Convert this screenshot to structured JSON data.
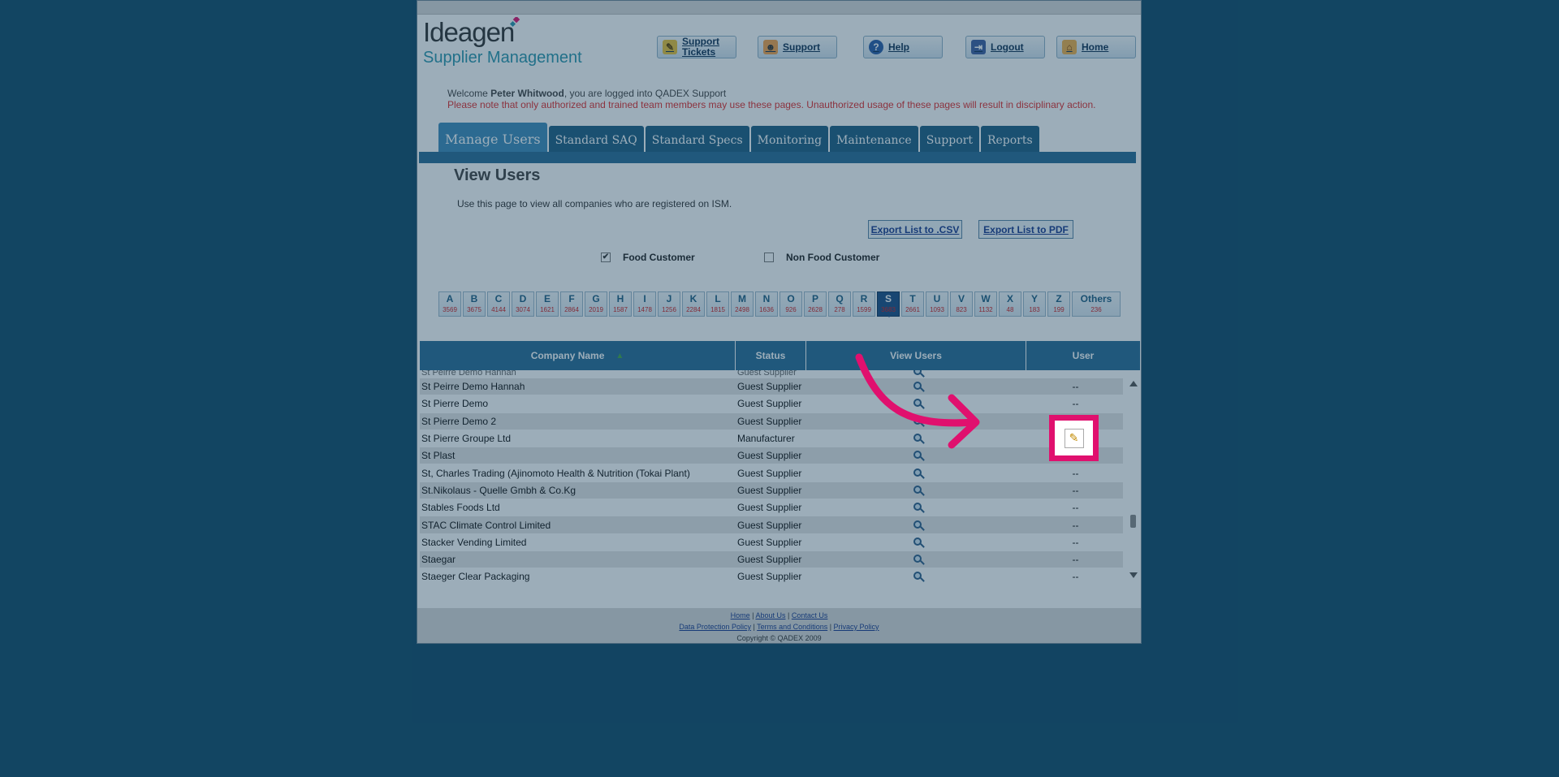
{
  "header": {
    "logo_main": "Ideagen",
    "logo_sub": "Supplier Management",
    "buttons": [
      {
        "label": "Support Tickets",
        "icon": "ticket-icon"
      },
      {
        "label": "Support",
        "icon": "user-icon"
      },
      {
        "label": "Help",
        "icon": "help-icon"
      },
      {
        "label": "Logout",
        "icon": "logout-icon"
      },
      {
        "label": "Home",
        "icon": "home-icon"
      }
    ],
    "welcome_prefix": "Welcome ",
    "welcome_user": "Peter Whitwood",
    "welcome_suffix": ", you are logged into QADEX Support",
    "warning": "Please note that only authorized and trained team members may use these pages. Unauthorized usage of these pages will result in disciplinary action."
  },
  "tabs": [
    "Manage Users",
    "Standard SAQ",
    "Standard Specs",
    "Monitoring",
    "Maintenance",
    "Support",
    "Reports"
  ],
  "page": {
    "title": "View Users",
    "intro": "Use this page to view all companies who are registered on ISM.",
    "export_csv": "Export List to .CSV",
    "export_pdf": "Export List to PDF",
    "filter_food": "Food Customer",
    "filter_food_checked": true,
    "filter_nonfood": "Non Food Customer",
    "filter_nonfood_checked": false
  },
  "alphabet": [
    {
      "l": "A",
      "c": "3569"
    },
    {
      "l": "B",
      "c": "3675"
    },
    {
      "l": "C",
      "c": "4144"
    },
    {
      "l": "D",
      "c": "3074"
    },
    {
      "l": "E",
      "c": "1621"
    },
    {
      "l": "F",
      "c": "2864"
    },
    {
      "l": "G",
      "c": "2019"
    },
    {
      "l": "H",
      "c": "1587"
    },
    {
      "l": "I",
      "c": "1478"
    },
    {
      "l": "J",
      "c": "1256"
    },
    {
      "l": "K",
      "c": "2284"
    },
    {
      "l": "L",
      "c": "1815"
    },
    {
      "l": "M",
      "c": "2498"
    },
    {
      "l": "N",
      "c": "1636"
    },
    {
      "l": "O",
      "c": "926"
    },
    {
      "l": "P",
      "c": "2628"
    },
    {
      "l": "Q",
      "c": "278"
    },
    {
      "l": "R",
      "c": "1599"
    },
    {
      "l": "S",
      "c": "3683",
      "active": true
    },
    {
      "l": "T",
      "c": "2661"
    },
    {
      "l": "U",
      "c": "1093"
    },
    {
      "l": "V",
      "c": "823"
    },
    {
      "l": "W",
      "c": "1132"
    },
    {
      "l": "X",
      "c": "48"
    },
    {
      "l": "Y",
      "c": "183"
    },
    {
      "l": "Z",
      "c": "199"
    },
    {
      "l": "Others",
      "c": "236"
    }
  ],
  "table": {
    "headers": [
      "Company Name",
      "Status",
      "View Users",
      "User"
    ],
    "partial_row": {
      "name": "St Peirre Demo Hannah",
      "status": "Guest Supplier"
    },
    "rows": [
      {
        "name": "St Peirre Demo Hannah",
        "status": "Guest Supplier",
        "user": "--"
      },
      {
        "name": "St Pierre Demo",
        "status": "Guest Supplier",
        "user": "--"
      },
      {
        "name": "St Pierre Demo 2",
        "status": "Guest Supplier",
        "user": "--"
      },
      {
        "name": "St Pierre Groupe Ltd",
        "status": "Manufacturer",
        "user": "edit"
      },
      {
        "name": "St Plast",
        "status": "Guest Supplier",
        "user": "--"
      },
      {
        "name": "St, Charles Trading (Ajinomoto Health & Nutrition (Tokai Plant)",
        "status": "Guest Supplier",
        "user": "--"
      },
      {
        "name": "St.Nikolaus - Quelle Gmbh & Co.Kg",
        "status": "Guest Supplier",
        "user": "--"
      },
      {
        "name": "Stables Foods Ltd",
        "status": "Guest Supplier",
        "user": "--"
      },
      {
        "name": "STAC Climate Control Limited",
        "status": "Guest Supplier",
        "user": "--"
      },
      {
        "name": "Stacker Vending Limited",
        "status": "Guest Supplier",
        "user": "--"
      },
      {
        "name": "Staegar",
        "status": "Guest Supplier",
        "user": "--"
      },
      {
        "name": "Staeger Clear Packaging",
        "status": "Guest Supplier",
        "user": "--"
      }
    ]
  },
  "footer": {
    "links1": [
      "Home",
      "About Us",
      "Contact Us"
    ],
    "links2": [
      "Data Protection Policy",
      "Terms and Conditions",
      "Privacy Policy"
    ],
    "copyright": "Copyright © QADEX 2009"
  },
  "colors": {
    "accent": "#e0106e",
    "nav": "#2a6d96",
    "background": "#124b69"
  }
}
